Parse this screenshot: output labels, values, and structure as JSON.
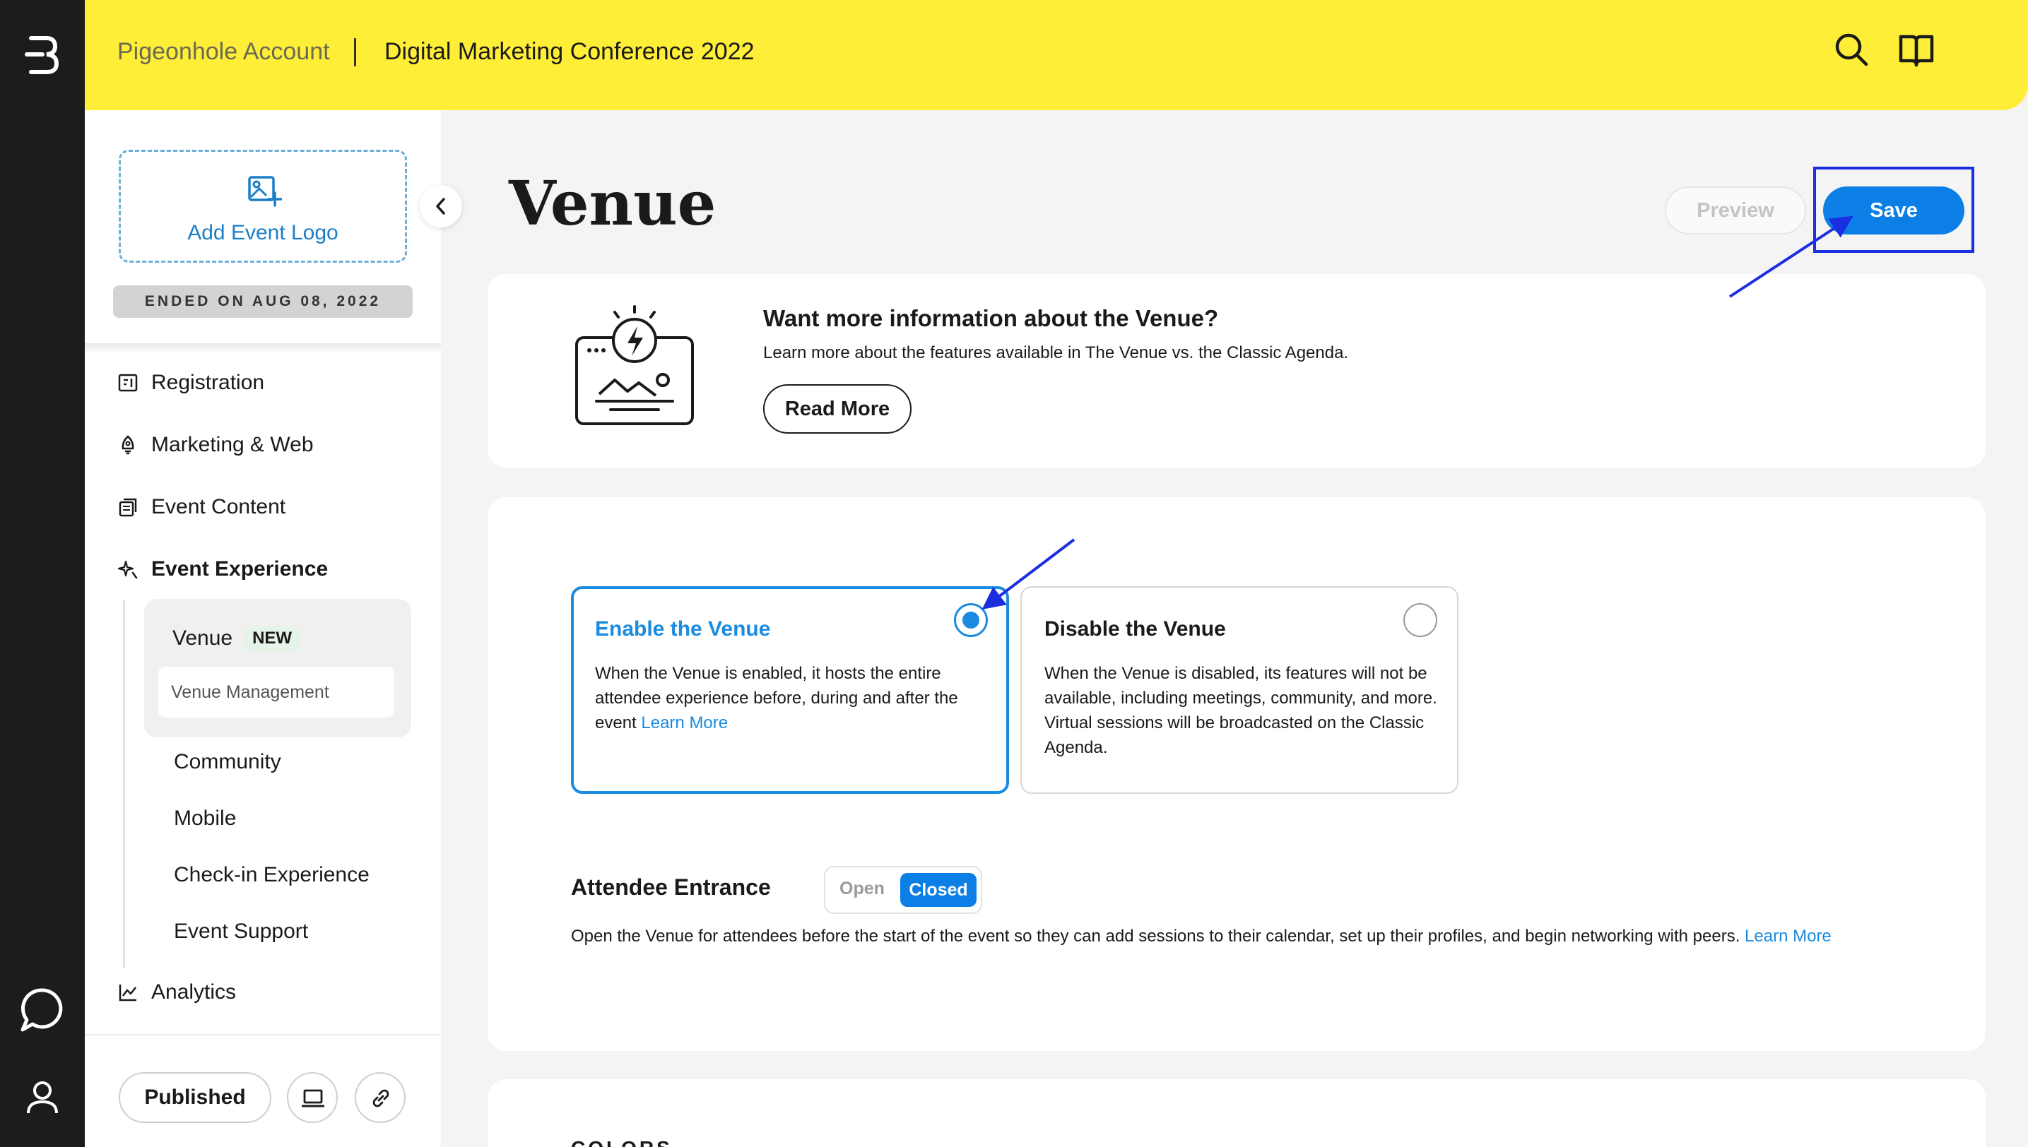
{
  "topbar": {
    "account": "Pigeonhole Account",
    "event_name": "Digital Marketing Conference 2022"
  },
  "sidebar": {
    "add_logo_label": "Add Event Logo",
    "ended_label": "ENDED ON AUG 08, 2022",
    "items": [
      {
        "label": "Registration",
        "icon": "registration-icon"
      },
      {
        "label": "Marketing & Web",
        "icon": "rocket-icon"
      },
      {
        "label": "Event Content",
        "icon": "content-icon"
      },
      {
        "label": "Event Experience",
        "icon": "sparkle-icon"
      }
    ],
    "venue_label": "Venue",
    "new_badge": "NEW",
    "venue_management": "Venue Management",
    "sub_items": [
      "Community",
      "Mobile",
      "Check-in Experience",
      "Event Support"
    ],
    "analytics_label": "Analytics",
    "published_label": "Published"
  },
  "page": {
    "title": "Venue",
    "preview_label": "Preview",
    "save_label": "Save"
  },
  "info": {
    "title": "Want more information about the Venue?",
    "description": "Learn more about the features available in The Venue vs. the Classic Agenda.",
    "read_more": "Read More"
  },
  "venue_options": {
    "enable": {
      "title": "Enable the Venue",
      "description": "When the Venue is enabled, it hosts the entire attendee experience before, during and after the event ",
      "link": "Learn More",
      "selected": true
    },
    "disable": {
      "title": "Disable the Venue",
      "description": "When the Venue is disabled, its features will not be available, including meetings, community, and more. Virtual sessions will be broadcasted on the Classic Agenda.",
      "selected": false
    }
  },
  "entrance": {
    "label": "Attendee Entrance",
    "open_label": "Open",
    "closed_label": "Closed",
    "selected": "Closed",
    "description": "Open the Venue for attendees before the start of the event so they can add sessions to their calendar, set up their profiles, and begin networking with peers. ",
    "link": "Learn More"
  },
  "colors_section": {
    "label": "COLORS"
  },
  "colors": {
    "topbar": "#ffee38",
    "accent": "#0b7fe6",
    "rail": "#1c1c1c",
    "annotation": "#1b2fe0"
  }
}
